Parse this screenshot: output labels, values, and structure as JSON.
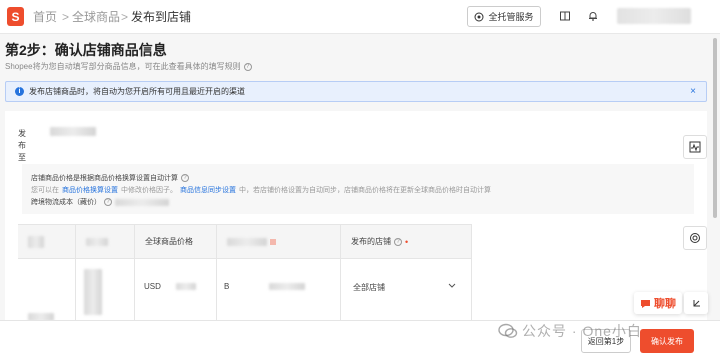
{
  "header": {
    "logo_text": "S",
    "breadcrumb": [
      "首页",
      "全球商品",
      "发布到店铺"
    ],
    "separator": ">",
    "service_button": "全托管服务",
    "icons": [
      "book-icon",
      "bell-icon"
    ]
  },
  "page": {
    "title": "第2步：确认店铺商品信息",
    "subtitle": "Shopee将为您自动填写部分商品信息，可在此查看具体的填写规则"
  },
  "notice": {
    "text": "发布店铺商品时，将自动为您开启所有可用且最近开启的渠道",
    "close": "×"
  },
  "publish": {
    "label_line1": "发布",
    "label_line2": "至"
  },
  "calc": {
    "line1": "店铺商品价格是根据商品价格换算设置自动计算",
    "line2_pre": "您可以在",
    "line2_link1": "商品价格换算设置",
    "line2_mid1": "中修改价格因子。",
    "line2_link2": "商品信息同步设置",
    "line2_mid2": "中，若店铺价格设置为自动同步，店铺商品价格将在更新全球商品价格时自动计算",
    "line3": "跨境物流成本（藏价）"
  },
  "table": {
    "headers": [
      "全球商品价格",
      "发布的店铺"
    ],
    "currency": "USD",
    "cell_b": "B",
    "shop_value": "全部店铺"
  },
  "chat": {
    "label": "聊聊"
  },
  "footer": {
    "back_label": "返回第1步",
    "confirm_label": "确认发布"
  },
  "watermark": {
    "text": "公众号 · One小白"
  },
  "colors": {
    "brand": "#ee4d2d",
    "link": "#2673dd",
    "notice_bg": "#e8f0fd"
  }
}
